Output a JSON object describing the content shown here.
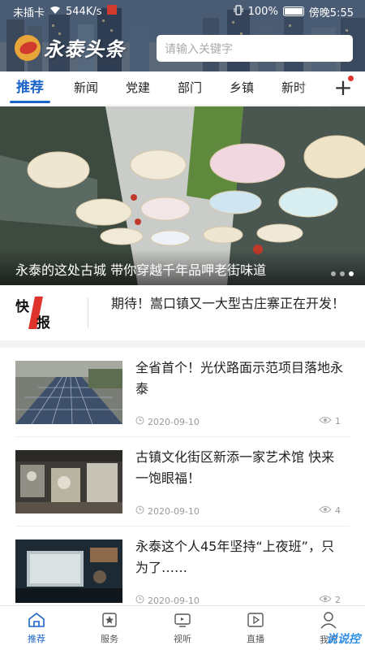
{
  "status": {
    "carrier": "未插卡",
    "speed": "544K/s",
    "battery": "100%",
    "time": "傍晚5:55"
  },
  "header": {
    "app_name": "永泰头条",
    "search_placeholder": "请输入关键字"
  },
  "tabs": [
    {
      "label": "推荐",
      "active": true
    },
    {
      "label": "新闻",
      "active": false
    },
    {
      "label": "党建",
      "active": false
    },
    {
      "label": "部门",
      "active": false
    },
    {
      "label": "乡镇",
      "active": false
    },
    {
      "label": "新时",
      "active": false
    }
  ],
  "tabs_add_icon": "plus-icon",
  "banner": {
    "caption": "永泰的这处古城 带你穿越千年品呷老街味道",
    "slide_count": 3,
    "current_slide": 3
  },
  "flash": {
    "badge": "快报",
    "text": "期待！嵩口镇又一大型古庄寨正在开发！"
  },
  "news": [
    {
      "title": "全省首个！光伏路面示范项目落地永泰",
      "date": "2020-09-10",
      "views": "1",
      "thumb": "solar-road"
    },
    {
      "title": "古镇文化街区新添一家艺术馆 快来一饱眼福！",
      "date": "2020-09-10",
      "views": "4",
      "thumb": "art-gallery"
    },
    {
      "title": "永泰这个人45年坚持“上夜班”，只为了……",
      "date": "2020-09-10",
      "views": "2",
      "thumb": "cinema"
    }
  ],
  "bottom_nav": [
    {
      "label": "推荐",
      "icon": "home-icon",
      "active": true
    },
    {
      "label": "服务",
      "icon": "star-icon",
      "active": false
    },
    {
      "label": "视听",
      "icon": "tv-icon",
      "active": false
    },
    {
      "label": "直播",
      "icon": "play-icon",
      "active": false
    },
    {
      "label": "我的",
      "icon": "user-icon",
      "active": false
    }
  ],
  "watermark": "说说控",
  "colors": {
    "accent": "#1b64c8",
    "badge_red": "#e0332b"
  }
}
